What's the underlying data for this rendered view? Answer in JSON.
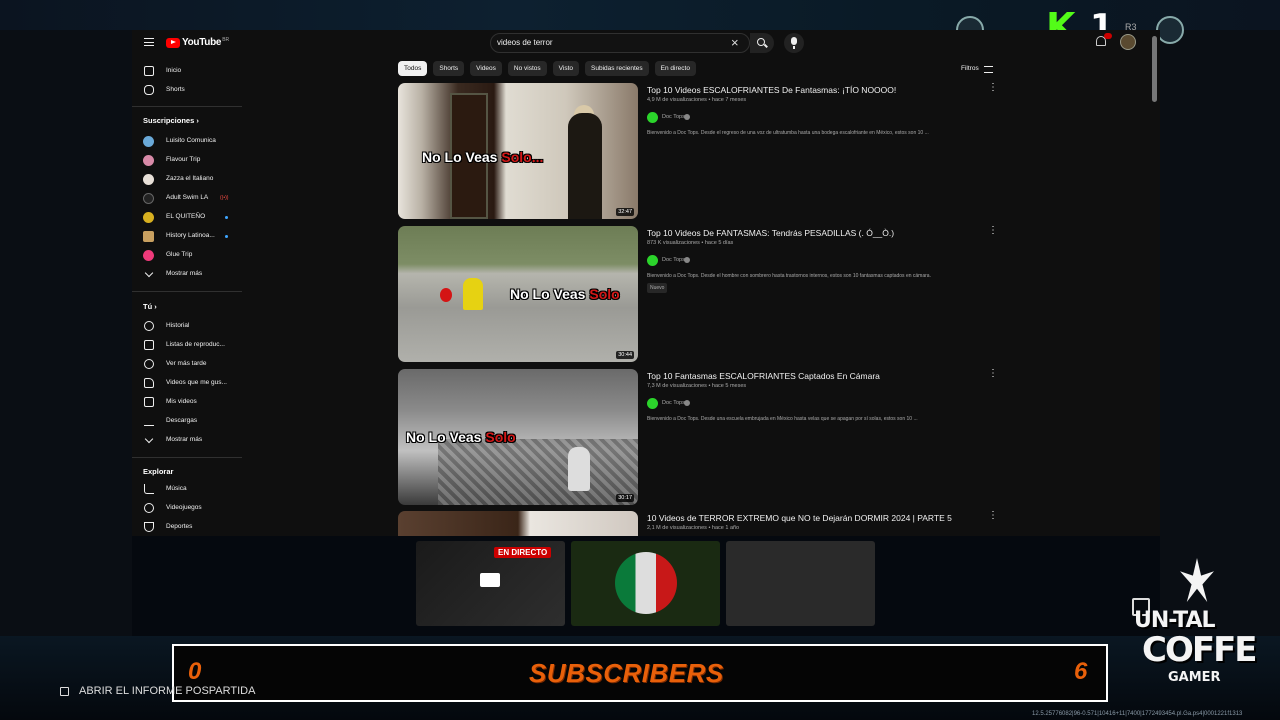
{
  "overlay": {
    "kick_count": "1",
    "r3_label": "R3",
    "subscribers_label": "SUBSCRIBERS",
    "subscribers_left": "0",
    "subscribers_right": "6",
    "report_label": "ABRIR EL INFORME POSPARTIDA",
    "live_badge": "EN DIRECTO",
    "brand_line1": "UN-TAL",
    "brand_line2": "COFFE",
    "brand_line3": "GAMER",
    "version": "12.5.25776082|96-0.571|10416+11|7400|1772493454.pl.Ga.ps4|0001221f1313"
  },
  "youtube": {
    "logo_text": "YouTube",
    "logo_cc": "BR",
    "search": {
      "value": "videos de terror"
    },
    "sidebar": {
      "main": [
        {
          "label": "Inicio",
          "icon": "home-icon"
        },
        {
          "label": "Shorts",
          "icon": "shorts-icon"
        }
      ],
      "subs_header": "Suscripciones",
      "subscriptions": [
        {
          "label": "Luisito Comunica",
          "color": "#6aa9d8"
        },
        {
          "label": "Flavour Trip",
          "color": "#d88aa8"
        },
        {
          "label": "Zazza el Italiano",
          "color": "#e8e0d8"
        },
        {
          "label": "Adult Swim LA",
          "color": "#222222"
        },
        {
          "label": "EL QUITEÑO",
          "color": "#d8b020"
        },
        {
          "label": "History Latinoa...",
          "color": "#c8a060"
        },
        {
          "label": "Glue Trip",
          "color": "#ef3a7a"
        }
      ],
      "more_label": "Mostrar más",
      "you_header": "Tú",
      "you_items": [
        {
          "label": "Historial",
          "icon": "history-icon"
        },
        {
          "label": "Listas de reproduc...",
          "icon": "playlist-icon"
        },
        {
          "label": "Ver más tarde",
          "icon": "clock-icon"
        },
        {
          "label": "Videos que me gus...",
          "icon": "thumbs-up-icon"
        },
        {
          "label": "Mis videos",
          "icon": "my-videos-icon"
        },
        {
          "label": "Descargas",
          "icon": "download-icon"
        },
        {
          "label": "Mostrar más",
          "icon": "chevron-down-icon"
        }
      ],
      "explore_header": "Explorar",
      "explore_items": [
        {
          "label": "Música",
          "icon": "music-icon"
        },
        {
          "label": "Videojuegos",
          "icon": "gamepad-icon"
        },
        {
          "label": "Deportes",
          "icon": "trophy-icon"
        }
      ]
    },
    "chips": [
      "Todos",
      "Shorts",
      "Videos",
      "No vistos",
      "Visto",
      "Subidas recientes",
      "En directo"
    ],
    "filters_label": "Filtros",
    "results": [
      {
        "title": "Top 10 Videos ESCALOFRIANTES De Fantasmas: ¡TÍO NOOOO!",
        "meta": "4,9 M de visualizaciones • hace 7 meses",
        "channel": "Doc Tops",
        "description": "Bienvenido a Doc Tops. Desde el regreso de una voz de ultratumba hasta una bodega escalofriante en México, estos son 10 ...",
        "duration": "32:47",
        "overlay_a": "No Lo Veas ",
        "overlay_b": "Solo..."
      },
      {
        "title": "Top 10 Videos De FANTASMAS: Tendrás PESADILLAS (. Ó__Ò.)",
        "meta": "873 K visualizaciones • hace 5 días",
        "channel": "Doc Tops",
        "description": "Bienvenido a Doc Tops. Desde el hombre con sombrero hasta trastornos internos, estos son 10 fantasmas captados en cámara.",
        "badge": "Nuevo",
        "duration": "30:44",
        "overlay_a": "No Lo Veas ",
        "overlay_b": "Solo"
      },
      {
        "title": "Top 10 Fantasmas ESCALOFRIANTES Captados En Cámara",
        "meta": "7,3 M de visualizaciones • hace 5 meses",
        "channel": "Doc Tops",
        "description": "Bienvenido a Doc Tops. Desde una escuela embrujada en México hasta velas que se apagan por sí solas, estos son 10 ...",
        "duration": "30:17",
        "overlay_a": "No Lo Veas ",
        "overlay_b": "Solo"
      },
      {
        "title": "10 Videos de TERROR EXTREMO que NO te Dejarán DORMIR 2024 | PARTE 5",
        "meta": "2,1 M de visualizaciones • hace 1 año"
      }
    ]
  }
}
